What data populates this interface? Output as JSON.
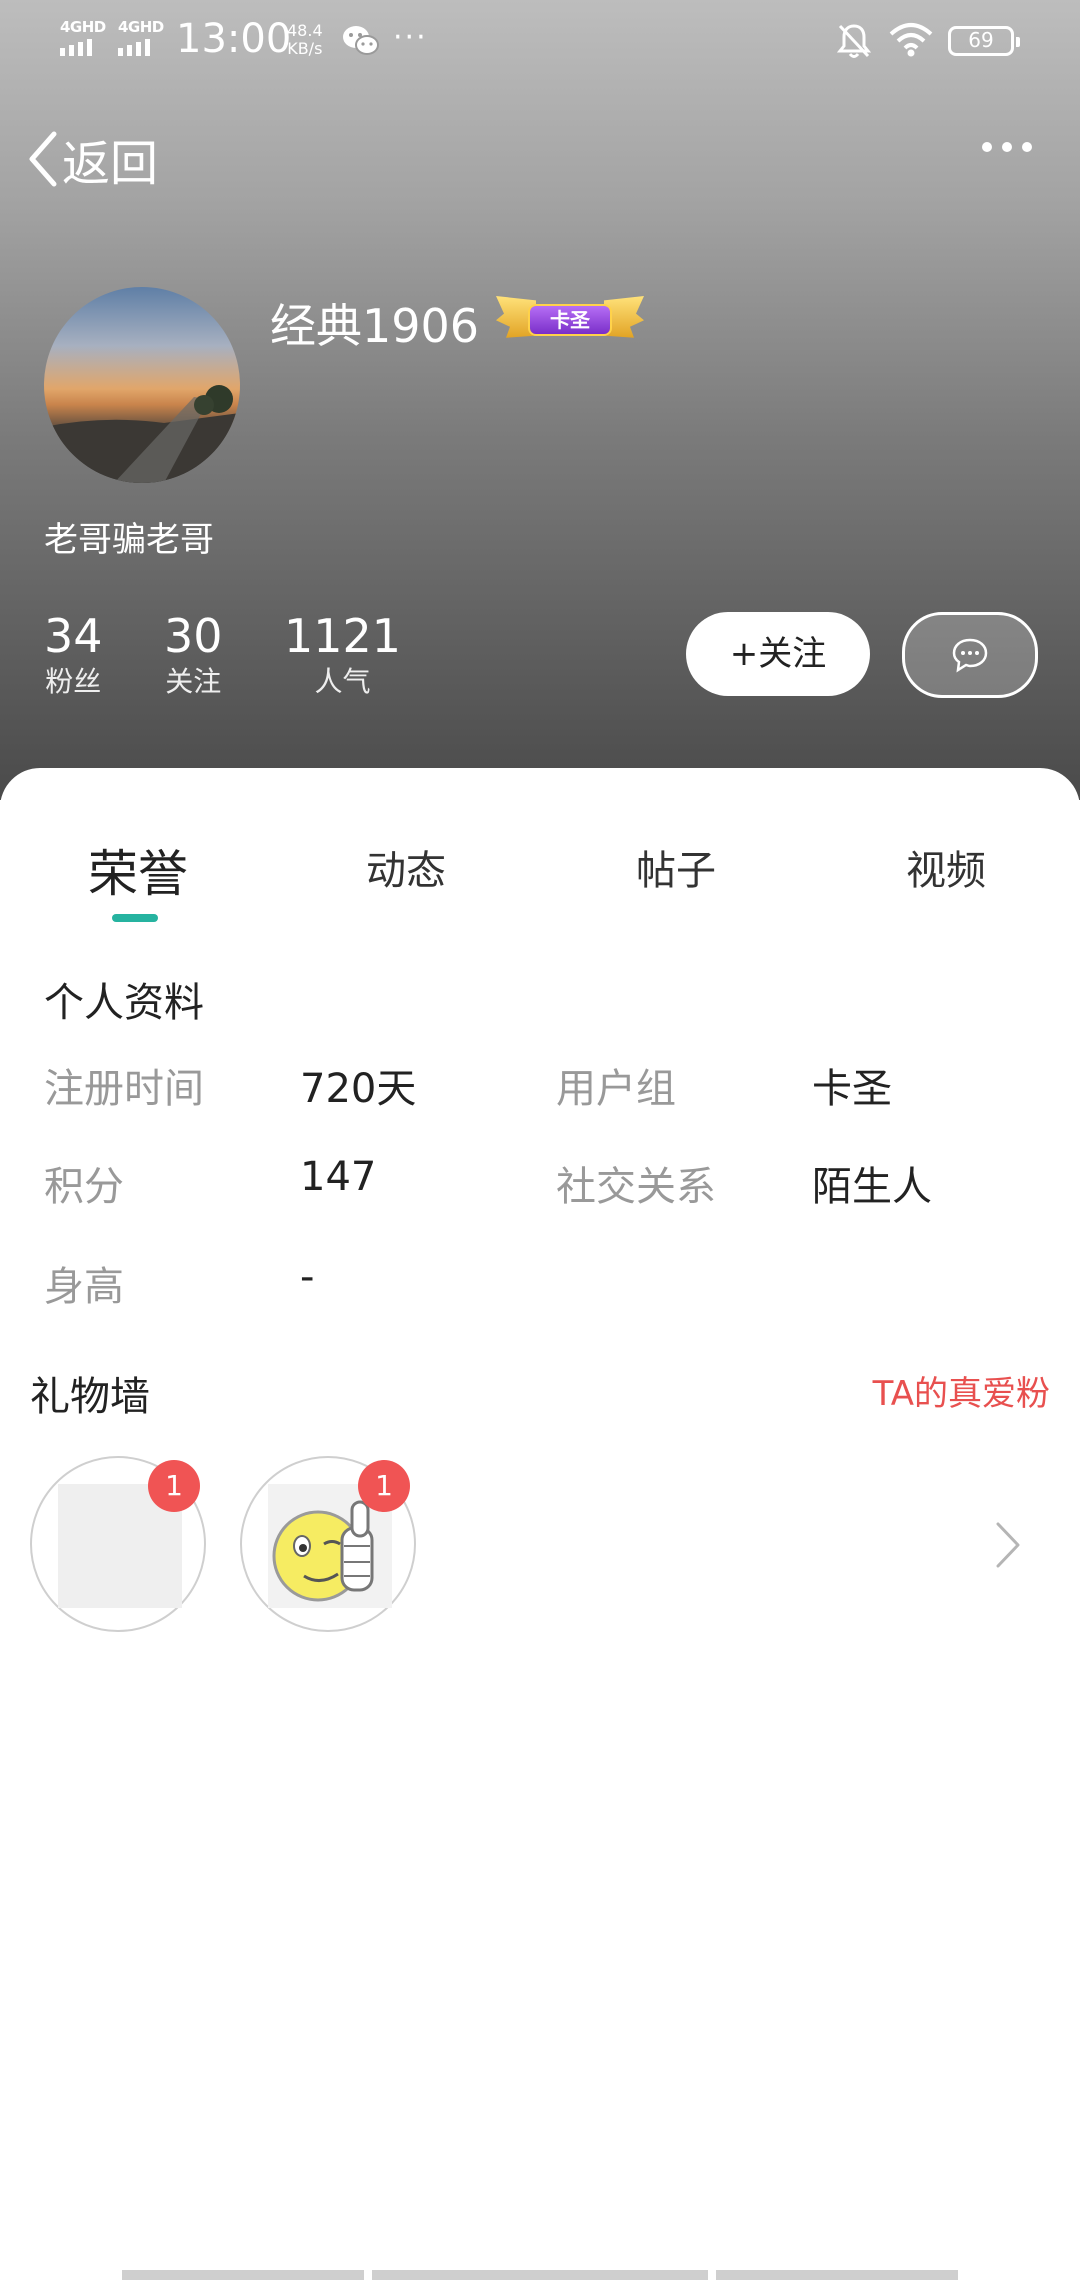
{
  "status_bar": {
    "network_1": "4GHD",
    "network_2": "4GHD",
    "time": "13:00",
    "speed_value": "48.4",
    "speed_unit": "KB/s",
    "more": "···",
    "battery": "69"
  },
  "nav": {
    "back_label": "返回"
  },
  "profile": {
    "username": "经典1906",
    "badge_label": "卡圣",
    "signature": "老哥骗老哥",
    "stats": [
      {
        "value": "34",
        "label": "粉丝"
      },
      {
        "value": "30",
        "label": "关注"
      },
      {
        "value": "1121",
        "label": "人气"
      }
    ],
    "follow_label": "+关注"
  },
  "tabs": [
    {
      "label": "荣誉",
      "active": true
    },
    {
      "label": "动态",
      "active": false
    },
    {
      "label": "帖子",
      "active": false
    },
    {
      "label": "视频",
      "active": false
    }
  ],
  "personal_info": {
    "title": "个人资料",
    "register_label": "注册时间",
    "register_value": "720天",
    "group_label": "用户组",
    "group_value": "卡圣",
    "points_label": "积分",
    "points_value": "147",
    "relation_label": "社交关系",
    "relation_value": "陌生人",
    "height_label": "身高",
    "height_value": "-"
  },
  "gift_wall": {
    "title": "礼物墙",
    "fans_link": "TA的真爱粉",
    "gifts": [
      {
        "count": "1",
        "icon": "placeholder"
      },
      {
        "count": "1",
        "icon": "thumbs-up-smiley"
      }
    ]
  },
  "colors": {
    "accent": "#26b3a0",
    "link_red": "#e8504f",
    "badge_red": "#f05454"
  }
}
